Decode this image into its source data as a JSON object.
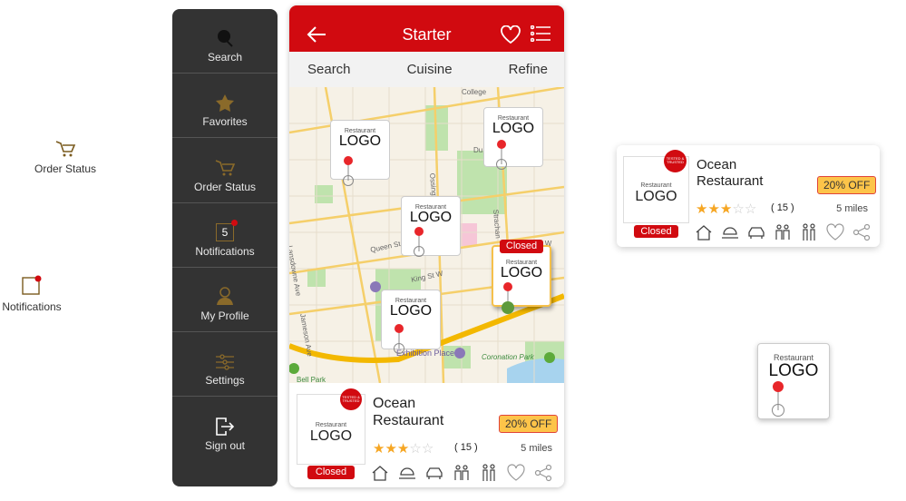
{
  "floating": {
    "order_status": "Order Status",
    "notifications": "Notifications"
  },
  "sidebar": {
    "items": [
      {
        "label": "Search",
        "icon": "search-icon"
      },
      {
        "label": "Favorites",
        "icon": "star-icon"
      },
      {
        "label": "Order Status",
        "icon": "cart-icon"
      },
      {
        "label": "Notifications",
        "icon": "notification-icon",
        "badge": "5"
      },
      {
        "label": "My Profile",
        "icon": "profile-icon"
      },
      {
        "label": "Settings",
        "icon": "sliders-icon"
      },
      {
        "label": "Sign out",
        "icon": "sign-out-icon"
      }
    ]
  },
  "header": {
    "title": "Starter"
  },
  "tabs": [
    "Search",
    "Cuisine",
    "Refine"
  ],
  "map": {
    "labels": {
      "college": "College",
      "dundas": "Du",
      "ossington": "Ossington",
      "strachan": "Strachan",
      "queen": "Queen St",
      "king": "King St W",
      "stw": "St W",
      "jameson": "Jameson Ave",
      "lansdowne": "Lansdowne Ave",
      "exhibition": "Exhibition Place",
      "coronation": "Coronation Park",
      "bell": "Bell Park"
    },
    "marker": {
      "small": "Restaurant",
      "big": "LOGO"
    },
    "closed": "Closed"
  },
  "restaurant": {
    "name_line1": "Ocean",
    "name_line2": "Restaurant",
    "discount": "20% OFF",
    "rating": 3,
    "max_rating": 5,
    "reviews": "( 15 )",
    "distance": "5 miles",
    "status": "Closed",
    "seal": "TESTED & TRUSTED",
    "logo_small": "Restaurant",
    "logo_big": "LOGO"
  },
  "colors": {
    "brand": "#d10a10",
    "sidebar": "#333333",
    "accent_gold": "#8a6a2a",
    "star": "#f6a623",
    "discount_bg": "#fdc449"
  }
}
